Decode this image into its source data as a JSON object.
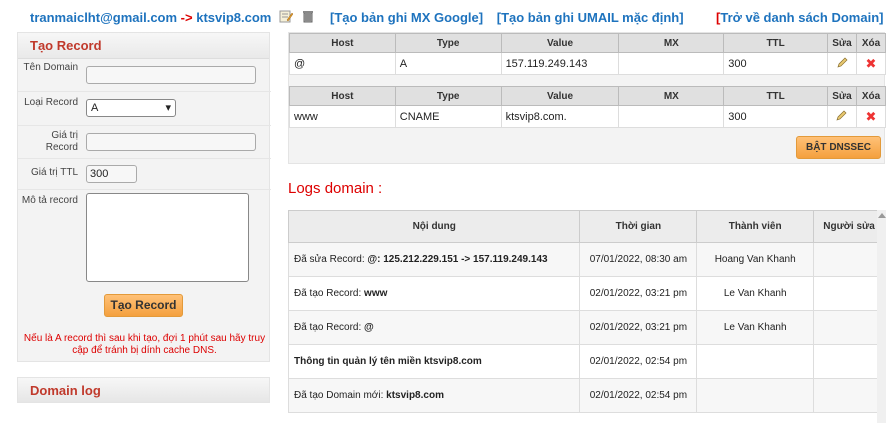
{
  "header": {
    "email": "tranmaiclht@gmail.com",
    "arrow": "->",
    "domain": "ktsvip8.com",
    "mx_google": "[Tạo bản ghi MX Google]",
    "umail": "[Tạo bản ghi UMAIL mặc định]",
    "back_open": "[",
    "back_text": "Trở về danh sách Domain]"
  },
  "create_record": {
    "title": "Tạo Record",
    "domain_label": "Tên Domain",
    "type_label": "Loại Record",
    "type_value": "A",
    "value_label": "Giá trị Record",
    "ttl_label": "Giá trị TTL",
    "ttl_value": "300",
    "desc_label": "Mô tả record",
    "submit": "Tạo Record",
    "note": "Nếu là A record thì sau khi tạo, đợi 1 phút sau hãy truy cập để tránh bị dính cache DNS."
  },
  "domain_log": "Domain log",
  "records_header": [
    "Host",
    "Type",
    "Value",
    "MX",
    "TTL",
    "Sửa",
    "Xóa"
  ],
  "records": [
    {
      "host": "@",
      "type": "A",
      "value": "157.119.249.143",
      "mx": "",
      "ttl": "300"
    },
    {
      "host": "www",
      "type": "CNAME",
      "value": "ktsvip8.com.",
      "mx": "",
      "ttl": "300"
    }
  ],
  "dnssec_button": "BẬT DNSSEC",
  "logs": {
    "title": "Logs domain :",
    "headers": [
      "Nội dung",
      "Thời gian",
      "Thành viên",
      "Người sửa"
    ],
    "rows": [
      {
        "prefix": "Đã sửa Record: ",
        "bold": "@: 125.212.229.151 -> 157.119.249.143",
        "time": "07/01/2022, 08:30 am",
        "member": "Hoang Van Khanh",
        "editor": ""
      },
      {
        "prefix": "Đã tạo Record: ",
        "bold": "www",
        "time": "02/01/2022, 03:21 pm",
        "member": "Le Van Khanh",
        "editor": ""
      },
      {
        "prefix": "Đã tạo Record: ",
        "bold": "@",
        "time": "02/01/2022, 03:21 pm",
        "member": "Le Van Khanh",
        "editor": ""
      },
      {
        "prefix": "",
        "bold": "Thông tin quản lý tên miền ktsvip8.com",
        "time": "02/01/2022, 02:54 pm",
        "member": "",
        "editor": ""
      },
      {
        "prefix": "Đã tạo Domain mới: ",
        "bold": "ktsvip8.com",
        "time": "02/01/2022, 02:54 pm",
        "member": "",
        "editor": ""
      }
    ]
  },
  "colors": {
    "link": "#1e73be",
    "accent_red": "#d00",
    "button_orange": "#f4a03e"
  }
}
